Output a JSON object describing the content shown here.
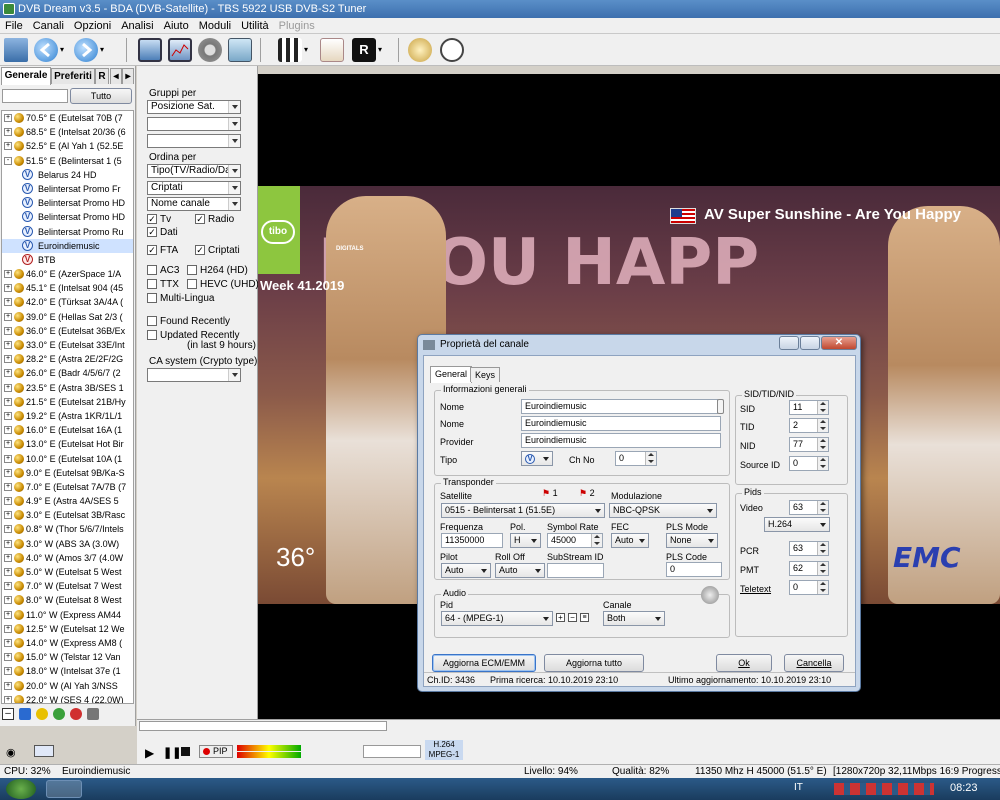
{
  "window": {
    "title": "DVB Dream v3.5  -  BDA (DVB-Satellite)  -  TBS 5922 USB DVB-S2 Tuner"
  },
  "menu": [
    "File",
    "Canali",
    "Opzioni",
    "Analisi",
    "Aiuto",
    "Moduli",
    "Utilità",
    "Plugins"
  ],
  "left_panel": {
    "tabs": [
      "Generale",
      "Preferiti",
      "R"
    ],
    "search_button": "Tutto",
    "tree": [
      {
        "label": "70.5° E (Eutelsat 70B (7",
        "type": "sat",
        "pm": "+"
      },
      {
        "label": "68.5° E (Intelsat 20/36 (6",
        "type": "sat",
        "pm": "+"
      },
      {
        "label": "52.5° E (Al Yah 1 (52.5E",
        "type": "sat",
        "pm": "+"
      },
      {
        "label": "51.5° E (Belintersat 1 (5",
        "type": "sat",
        "pm": "-"
      },
      {
        "label": "Belarus 24 HD",
        "type": "tv"
      },
      {
        "label": "Belintersat Promo Fr",
        "type": "tv"
      },
      {
        "label": "Belintersat Promo HD",
        "type": "tv"
      },
      {
        "label": "Belintersat Promo HD",
        "type": "tv"
      },
      {
        "label": "Belintersat Promo Ru",
        "type": "tv"
      },
      {
        "label": "Euroindiemusic",
        "type": "tv",
        "selected": true
      },
      {
        "label": "BTB",
        "type": "tv-red"
      },
      {
        "label": "46.0° E (AzerSpace 1/A",
        "type": "sat",
        "pm": "+"
      },
      {
        "label": "45.1° E (Intelsat 904 (45",
        "type": "sat",
        "pm": "+"
      },
      {
        "label": "42.0° E (Türksat 3A/4A (",
        "type": "sat",
        "pm": "+"
      },
      {
        "label": "39.0° E (Hellas Sat 2/3 (",
        "type": "sat",
        "pm": "+"
      },
      {
        "label": "36.0° E (Eutelsat 36B/Ex",
        "type": "sat",
        "pm": "+"
      },
      {
        "label": "33.0° E (Eutelsat 33E/Int",
        "type": "sat",
        "pm": "+"
      },
      {
        "label": "28.2° E (Astra 2E/2F/2G",
        "type": "sat",
        "pm": "+"
      },
      {
        "label": "26.0° E (Badr 4/5/6/7 (2",
        "type": "sat",
        "pm": "+"
      },
      {
        "label": "23.5° E (Astra 3B/SES 1",
        "type": "sat",
        "pm": "+"
      },
      {
        "label": "21.5° E (Eutelsat 21B/Hy",
        "type": "sat",
        "pm": "+"
      },
      {
        "label": "19.2° E (Astra 1KR/1L/1",
        "type": "sat",
        "pm": "+"
      },
      {
        "label": "16.0° E (Eutelsat 16A (1",
        "type": "sat",
        "pm": "+"
      },
      {
        "label": "13.0° E (Eutelsat Hot Bir",
        "type": "sat",
        "pm": "+"
      },
      {
        "label": "10.0° E (Eutelsat 10A (1",
        "type": "sat",
        "pm": "+"
      },
      {
        "label": "9.0° E (Eutelsat 9B/Ka-S",
        "type": "sat",
        "pm": "+"
      },
      {
        "label": "7.0° E (Eutelsat 7A/7B (7",
        "type": "sat",
        "pm": "+"
      },
      {
        "label": "4.9° E (Astra 4A/SES 5",
        "type": "sat",
        "pm": "+"
      },
      {
        "label": "3.0° E (Eutelsat 3B/Rasc",
        "type": "sat",
        "pm": "+"
      },
      {
        "label": "0.8° W (Thor 5/6/7/Intels",
        "type": "sat",
        "pm": "+"
      },
      {
        "label": "3.0° W (ABS 3A (3.0W)",
        "type": "sat",
        "pm": "+"
      },
      {
        "label": "4.0° W (Amos 3/7 (4.0W",
        "type": "sat",
        "pm": "+"
      },
      {
        "label": "5.0° W (Eutelsat 5 West",
        "type": "sat",
        "pm": "+"
      },
      {
        "label": "7.0° W (Eutelsat 7 West",
        "type": "sat",
        "pm": "+"
      },
      {
        "label": "8.0° W (Eutelsat 8 West",
        "type": "sat",
        "pm": "+"
      },
      {
        "label": "11.0° W (Express AM44",
        "type": "sat",
        "pm": "+"
      },
      {
        "label": "12.5° W (Eutelsat 12 We",
        "type": "sat",
        "pm": "+"
      },
      {
        "label": "14.0° W (Express AM8 (",
        "type": "sat",
        "pm": "+"
      },
      {
        "label": "15.0° W (Telstar 12 Van",
        "type": "sat",
        "pm": "+"
      },
      {
        "label": "18.0° W (Intelsat 37e (1",
        "type": "sat",
        "pm": "+"
      },
      {
        "label": "20.0° W (Al Yah 3/NSS",
        "type": "sat",
        "pm": "+"
      },
      {
        "label": "22.0° W (SES 4 (22.0W)",
        "type": "sat",
        "pm": "+"
      }
    ]
  },
  "filter_panel": {
    "gruppi_label": "Gruppi per",
    "gruppi_combo": "Posizione Sat.",
    "ordina_label": "Ordina per",
    "ordina_combo1": "Tipo(TV/Radio/Dati",
    "ordina_combo2": "Criptati",
    "ordina_combo3": "Nome canale",
    "tv": "Tv",
    "radio": "Radio",
    "dati": "Dati",
    "fta": "FTA",
    "criptati": "Criptati",
    "ac3": "AC3",
    "h264": "H264 (HD)",
    "ttx": "TTX",
    "hevc": "HEVC (UHD)",
    "multilingua": "Multi-Lingua",
    "found_recently": "Found Recently",
    "updated_recently": "Updated Recently",
    "updated_note": "(in last 9 hours)",
    "ca_system": "CA system (Crypto type):"
  },
  "video": {
    "banner": "AV Super Sunshine -  Are You Happy",
    "week": "Week 41.2019",
    "deg": "36°",
    "bigtext": "R YOU HAPP",
    "tibo": "tibo",
    "digitals": "DIGITALS",
    "emc": "EMC"
  },
  "dialog": {
    "title": "Proprietà del canale",
    "tabs": [
      "General",
      "Keys"
    ],
    "info_group": "Informazioni generali",
    "nome_label": "Nome",
    "nome_value": "Euroindiemusic",
    "nome2_label": "Nome",
    "nome2_value": "Euroindiemusic",
    "provider_label": "Provider",
    "provider_value": "Euroindiemusic",
    "tipo_label": "Tipo",
    "chno_label": "Ch No",
    "chno_value": "0",
    "sid_group": "SID/TID/NID",
    "sid_label": "SID",
    "sid_value": "11",
    "tid_label": "TID",
    "tid_value": "2",
    "nid_label": "NID",
    "nid_value": "77",
    "source_label": "Source ID",
    "source_value": "0",
    "transponder_group": "Transponder",
    "satellite_label": "Satellite",
    "sat_mark1": "1",
    "sat_mark2": "2",
    "satellite_value": "0515 - Belintersat 1 (51.5E)",
    "modulazione_label": "Modulazione",
    "modulazione_value": "NBC-QPSK",
    "freq_label": "Frequenza",
    "freq_value": "11350000",
    "pol_label": "Pol.",
    "pol_value": "H",
    "sr_label": "Symbol Rate",
    "sr_value": "45000",
    "fec_label": "FEC",
    "fec_value": "Auto",
    "plsmode_label": "PLS Mode",
    "plsmode_value": "None",
    "pilot_label": "Pilot",
    "pilot_value": "Auto",
    "rolloff_label": "Roll Off",
    "rolloff_value": "Auto",
    "substream_label": "SubStream ID",
    "substream_value": "",
    "plscode_label": "PLS Code",
    "plscode_value": "0",
    "pids_group": "Pids",
    "video_label": "Video",
    "video_value": "63",
    "video_codec": "H.264",
    "pcr_label": "PCR",
    "pcr_value": "63",
    "pmt_label": "PMT",
    "pmt_value": "62",
    "teletext_label": "Teletext",
    "teletext_value": "0",
    "audio_group": "Audio",
    "pid_label": "Pid",
    "pid_value": "64  -  (MPEG-1)",
    "canale_label": "Canale",
    "canale_value": "Both",
    "btn_ecm": "Aggiorna ECM/EMM",
    "btn_all": "Aggiorna tutto",
    "btn_ok": "Ok",
    "btn_cancel": "Cancella",
    "status_chid": "Ch.ID: 3436",
    "status_first": "Prima ricerca: 10.10.2019 23:10",
    "status_last": "Ultimo aggiornamento: 10.10.2019 23:10"
  },
  "playbar": {
    "pip": "PIP",
    "codec_video": "H.264",
    "codec_audio": "MPEG-1"
  },
  "status": {
    "cpu": "CPU: 32%",
    "channel": "Euroindiemusic",
    "livello": "Livello: 94%",
    "qualita": "Qualità: 82%",
    "tp": "11350 Mhz  H  45000  (51.5° E)",
    "video_info": "[1280x720p  32,11Mbps  16:9 Progressive]"
  },
  "taskbar": {
    "lang": "IT",
    "time": "08:23"
  }
}
